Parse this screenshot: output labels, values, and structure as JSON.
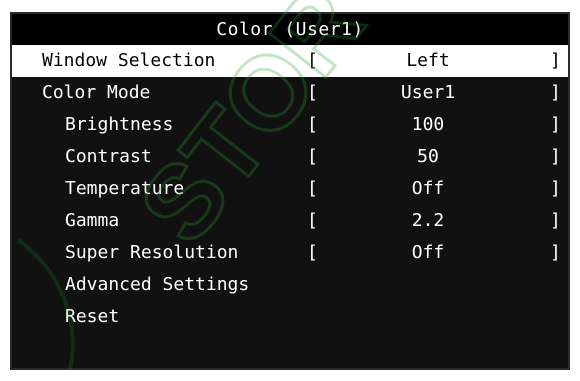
{
  "osd": {
    "title": "Color (User1)",
    "rows": [
      {
        "label": "Window Selection",
        "value": "Left",
        "bracket_open": "[",
        "bracket_close": "]"
      },
      {
        "label": "Color Mode",
        "value": "User1",
        "bracket_open": "[",
        "bracket_close": "]"
      },
      {
        "label": "Brightness",
        "value": "100",
        "bracket_open": "[",
        "bracket_close": "]"
      },
      {
        "label": "Contrast",
        "value": "50",
        "bracket_open": "[",
        "bracket_close": "]"
      },
      {
        "label": "Temperature",
        "value": "Off",
        "bracket_open": "[",
        "bracket_close": "]"
      },
      {
        "label": "Gamma",
        "value": "2.2",
        "bracket_open": "[",
        "bracket_close": "]"
      },
      {
        "label": "Super Resolution",
        "value": "Off",
        "bracket_open": "[",
        "bracket_close": "]"
      },
      {
        "label": "Advanced Settings"
      },
      {
        "label": "Reset"
      }
    ]
  },
  "colors": {
    "menu_background": "#111111",
    "title_background": "#000000",
    "selected_background": "#ffffff",
    "text": "#ffffff",
    "selected_text": "#000000",
    "watermark": "#2e9e3a"
  }
}
